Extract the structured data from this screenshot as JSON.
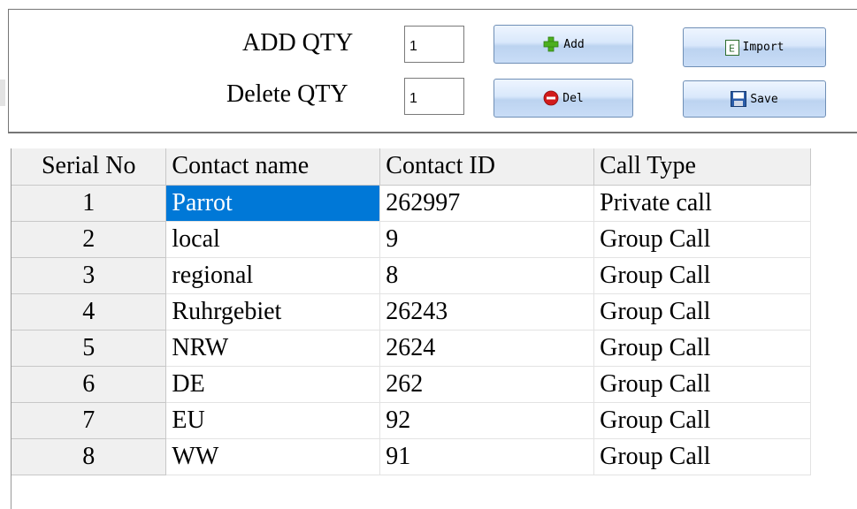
{
  "toolbar": {
    "add_qty_label": "ADD QTY",
    "add_qty_value": "1",
    "delete_qty_label": "Delete QTY",
    "delete_qty_value": "1",
    "add_button": "Add",
    "del_button": "Del",
    "import_button": "Import",
    "save_button": "Save"
  },
  "table": {
    "columns": [
      "Serial No",
      "Contact name",
      "Contact ID",
      "Call Type"
    ],
    "rows": [
      {
        "serial": "1",
        "name": "Parrot",
        "id": "262997",
        "type": "Private call",
        "selected": true
      },
      {
        "serial": "2",
        "name": "local",
        "id": "9",
        "type": "Group Call"
      },
      {
        "serial": "3",
        "name": "regional",
        "id": "8",
        "type": "Group Call"
      },
      {
        "serial": "4",
        "name": "Ruhrgebiet",
        "id": "26243",
        "type": "Group Call"
      },
      {
        "serial": "5",
        "name": "NRW",
        "id": "2624",
        "type": "Group Call"
      },
      {
        "serial": "6",
        "name": "DE",
        "id": "262",
        "type": "Group Call"
      },
      {
        "serial": "7",
        "name": "EU",
        "id": "92",
        "type": "Group Call"
      },
      {
        "serial": "8",
        "name": "WW",
        "id": "91",
        "type": "Group Call"
      }
    ]
  },
  "icons": {
    "add": "plus-icon",
    "del": "minus-circle-icon",
    "import": "excel-icon",
    "save": "floppy-disk-icon"
  },
  "colors": {
    "selection": "#0078d7",
    "header_bg": "#f0f0f0",
    "add_icon": "#4caf1e",
    "del_icon": "#d11a1a"
  }
}
